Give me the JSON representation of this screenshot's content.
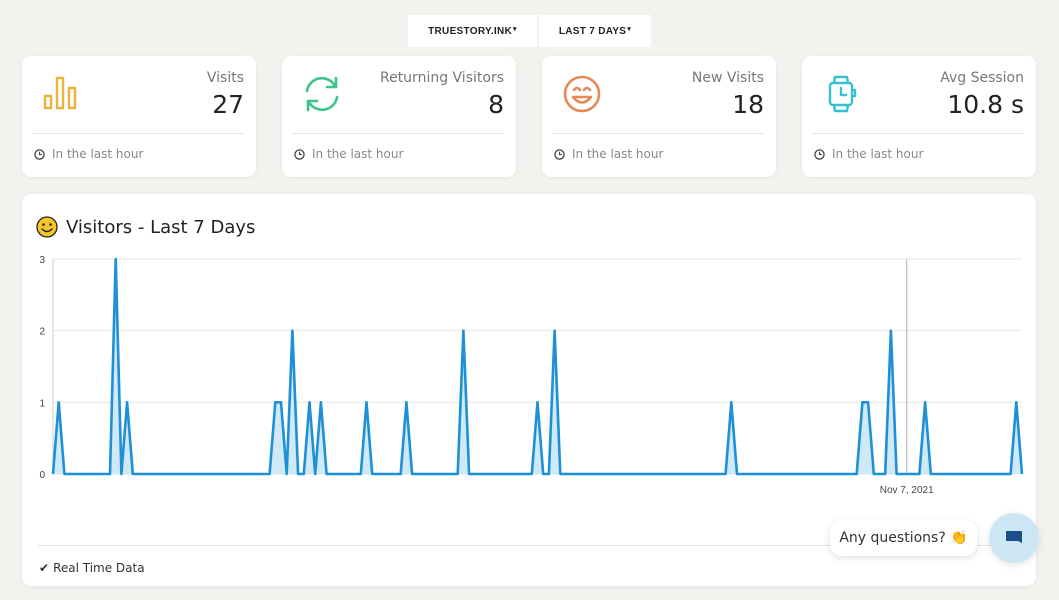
{
  "filters": {
    "site": "TRUESTORY.INK",
    "range": "LAST 7 DAYS",
    "caret": "▾"
  },
  "cards": [
    {
      "label": "Visits",
      "value": "27",
      "footer": "In the last hour",
      "icon": "bar-chart-icon",
      "color": "#e8b53a"
    },
    {
      "label": "Returning Visitors",
      "value": "8",
      "footer": "In the last hour",
      "icon": "refresh-icon",
      "color": "#3cc48a"
    },
    {
      "label": "New Visits",
      "value": "18",
      "footer": "In the last hour",
      "icon": "smile-icon",
      "color": "#e68a55"
    },
    {
      "label": "Avg Session",
      "value": "10.8 s",
      "footer": "In the last hour",
      "icon": "watch-icon",
      "color": "#35c2d0"
    }
  ],
  "chart_panel": {
    "title": "Visitors - Last 7 Days",
    "footer": "Real Time Data"
  },
  "chart_data": {
    "type": "area",
    "title": "Visitors - Last 7 Days",
    "xlabel": "",
    "ylabel": "",
    "ylim": [
      0,
      3
    ],
    "yticks": [
      0,
      1,
      2,
      3
    ],
    "x_tick_labels": [
      "Nov 7, 2021"
    ],
    "marker_label": "Nov 7, 2021",
    "grid": true,
    "color": "#1e90d8",
    "fill": "#cfe9f7",
    "series": [
      {
        "values": [
          0,
          1,
          0,
          0,
          0,
          0,
          0,
          0,
          0,
          0,
          0,
          3,
          0,
          1,
          0,
          0,
          0,
          0,
          0,
          0,
          0,
          0,
          0,
          0,
          0,
          0,
          0,
          0,
          0,
          0,
          0,
          0,
          0,
          0,
          0,
          0,
          0,
          0,
          0,
          1,
          1,
          0,
          2,
          0,
          0,
          1,
          0,
          1,
          0,
          0,
          0,
          0,
          0,
          0,
          0,
          1,
          0,
          0,
          0,
          0,
          0,
          0,
          1,
          0,
          0,
          0,
          0,
          0,
          0,
          0,
          0,
          0,
          2,
          0,
          0,
          0,
          0,
          0,
          0,
          0,
          0,
          0,
          0,
          0,
          0,
          1,
          0,
          0,
          2,
          0,
          0,
          0,
          0,
          0,
          0,
          0,
          0,
          0,
          0,
          0,
          0,
          0,
          0,
          0,
          0,
          0,
          0,
          0,
          0,
          0,
          0,
          0,
          0,
          0,
          0,
          0,
          0,
          0,
          0,
          1,
          0,
          0,
          0,
          0,
          0,
          0,
          0,
          0,
          0,
          0,
          0,
          0,
          0,
          0,
          0,
          0,
          0,
          0,
          0,
          0,
          0,
          0,
          1,
          1,
          0,
          0,
          0,
          2,
          0,
          0,
          0,
          0,
          0,
          1,
          0,
          0,
          0,
          0,
          0,
          0,
          0,
          0,
          0,
          0,
          0,
          0,
          0,
          0,
          0,
          1,
          0
        ]
      }
    ]
  },
  "chat": {
    "bubble_text": "Any questions? 👏",
    "button_icon": "chat-icon"
  }
}
